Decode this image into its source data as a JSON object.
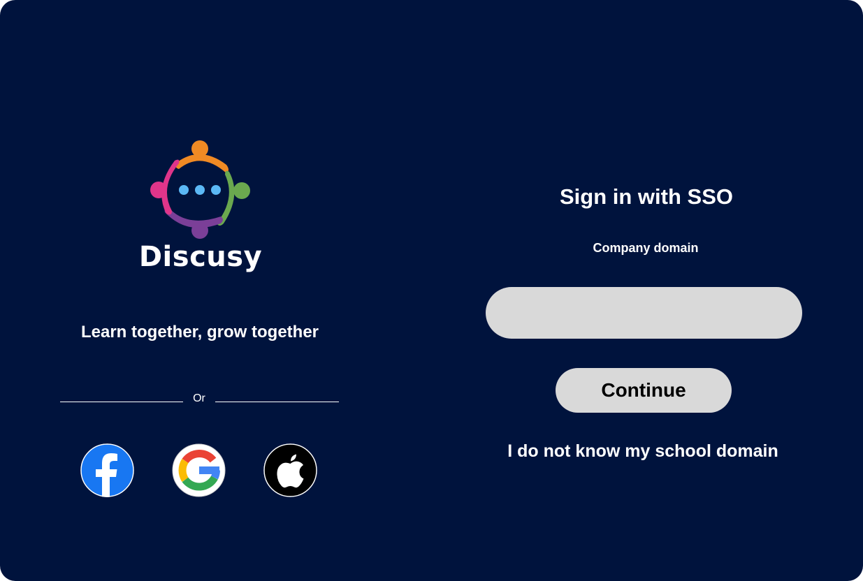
{
  "brand": {
    "name": "Discusy",
    "tagline": "Learn together, grow together",
    "logo_icon": "community-chat-logo"
  },
  "divider": {
    "text": "Or"
  },
  "social_logins": [
    {
      "name": "facebook",
      "icon": "facebook-icon",
      "color": "#1877f2"
    },
    {
      "name": "google",
      "icon": "google-icon",
      "color": "#ffffff"
    },
    {
      "name": "apple",
      "icon": "apple-icon",
      "color": "#000000"
    }
  ],
  "sso": {
    "title": "Sign in with SSO",
    "domain_label": "Company domain",
    "domain_value": "",
    "continue_label": "Continue",
    "help_link": "I do not know my school domain"
  },
  "colors": {
    "background": "#00133d",
    "field": "#d9d9d9",
    "text": "#ffffff",
    "logo_orange": "#f08a24",
    "logo_green": "#6aa84f",
    "logo_purple": "#7b3f98",
    "logo_pink": "#e0358a",
    "logo_dots": "#5bb8f5"
  }
}
